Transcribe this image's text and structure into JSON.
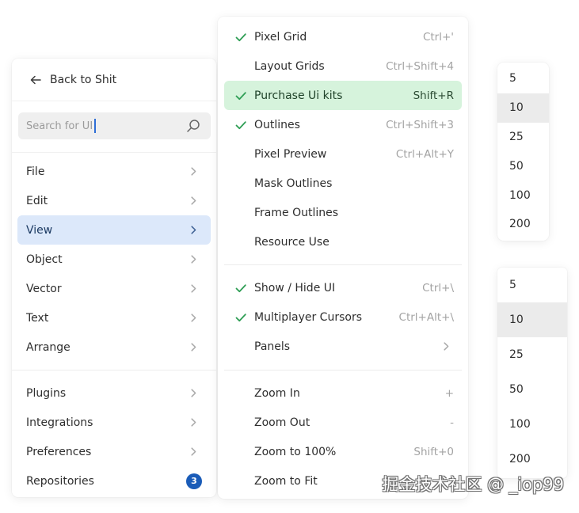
{
  "colors": {
    "view_highlight": "#dce8fa",
    "purchase_highlight": "#d6f3dc",
    "check_green": "#2f9e55",
    "badge_blue": "#1a5cb8",
    "caret_blue": "#2f6fd6",
    "zoom_highlight": "#ebebeb"
  },
  "icons": {
    "back": "arrow-left-icon",
    "search": "search-icon",
    "submenu": "chevron-right-icon",
    "checked": "check-icon"
  },
  "left_menu": {
    "back_label": "Back to Shit",
    "search": {
      "value": "Search for UI"
    },
    "items": [
      {
        "label": "File"
      },
      {
        "label": "Edit"
      },
      {
        "label": "View",
        "selected": true
      },
      {
        "label": "Object"
      },
      {
        "label": "Vector"
      },
      {
        "label": "Text"
      },
      {
        "label": "Arrange"
      }
    ],
    "secondary_items": [
      {
        "label": "Plugins"
      },
      {
        "label": "Integrations"
      },
      {
        "label": "Preferences"
      },
      {
        "label": "Repositories",
        "badge": "3"
      }
    ]
  },
  "view_menu": {
    "sections": [
      {
        "items": [
          {
            "label": "Pixel Grid",
            "shortcut": "Ctrl+'",
            "checked": true
          },
          {
            "label": "Layout Grids",
            "shortcut": "Ctrl+Shift+4",
            "checked": false
          },
          {
            "label": "Purchase Ui kits",
            "shortcut": "Shift+R",
            "checked": true,
            "highlighted": true
          },
          {
            "label": "Outlines",
            "shortcut": "Ctrl+Shift+3",
            "checked": true
          },
          {
            "label": "Pixel Preview",
            "shortcut": "Ctrl+Alt+Y",
            "checked": false
          },
          {
            "label": "Mask Outlines",
            "checked": false
          },
          {
            "label": "Frame Outlines",
            "checked": false
          },
          {
            "label": "Resource Use",
            "checked": false
          }
        ]
      },
      {
        "items": [
          {
            "label": "Show / Hide UI",
            "shortcut": "Ctrl+\\",
            "checked": true
          },
          {
            "label": "Multiplayer Cursors",
            "shortcut": "Ctrl+Alt+\\",
            "checked": true
          },
          {
            "label": "Panels",
            "submenu": true
          }
        ]
      },
      {
        "items": [
          {
            "label": "Zoom In",
            "shortcut": "+"
          },
          {
            "label": "Zoom Out",
            "shortcut": "-"
          },
          {
            "label": "Zoom to 100%",
            "shortcut": "Shift+0"
          },
          {
            "label": "Zoom to Fit"
          }
        ]
      }
    ]
  },
  "zoom_menus": [
    {
      "options": [
        {
          "value": "5"
        },
        {
          "value": "10",
          "selected": true
        },
        {
          "value": "25"
        },
        {
          "value": "50"
        },
        {
          "value": "100"
        },
        {
          "value": "200"
        }
      ]
    },
    {
      "options": [
        {
          "value": "5"
        },
        {
          "value": "10",
          "selected": true
        },
        {
          "value": "25"
        },
        {
          "value": "50"
        },
        {
          "value": "100"
        },
        {
          "value": "200"
        }
      ]
    }
  ],
  "watermark": "掘金技术社区 @ _iop99"
}
